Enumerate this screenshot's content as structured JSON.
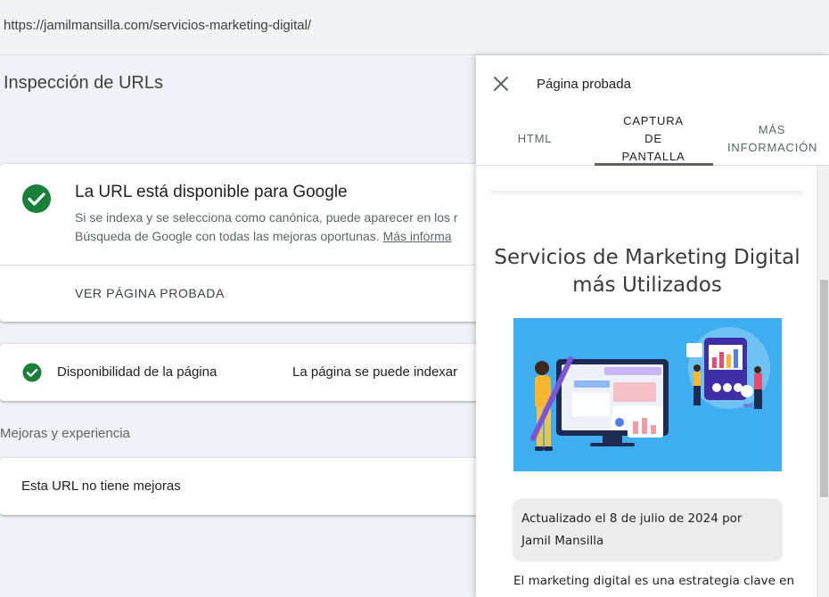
{
  "address_bar": {
    "url": "https://jamilmansilla.com/servicios-marketing-digital/"
  },
  "main": {
    "title": "Inspección de URLs",
    "status_card": {
      "title": "La URL está disponible para Google",
      "description_line1": "Si se indexa y se selecciona como canónica, puede aparecer en los r",
      "description_line2": "Búsqueda de Google con todas las mejoras oportunas.",
      "more_link": "Más informa",
      "action_label": "VER PÁGINA PROBADA",
      "status_color": "#188038"
    },
    "availability": {
      "label": "Disponibilidad de la página",
      "value": "La página se puede indexar"
    },
    "section_label": "Mejoras y experiencia",
    "improvements": {
      "text": "Esta URL no tiene mejoras"
    }
  },
  "panel": {
    "title": "Página probada",
    "tabs": [
      {
        "label": "HTML",
        "selected": false
      },
      {
        "label": "CAPTURA DE PANTALLA",
        "selected": true
      },
      {
        "label": "MÁS INFORMACIÓN",
        "selected": false
      }
    ],
    "screenshot": {
      "heading": "Servicios de Marketing Digital más Utilizados",
      "meta": "Actualizado el 8 de julio de 2024 por Jamil Mansilla",
      "body_start": "El marketing digital es una estrategia clave en",
      "hero_color": "#3faef0"
    }
  }
}
